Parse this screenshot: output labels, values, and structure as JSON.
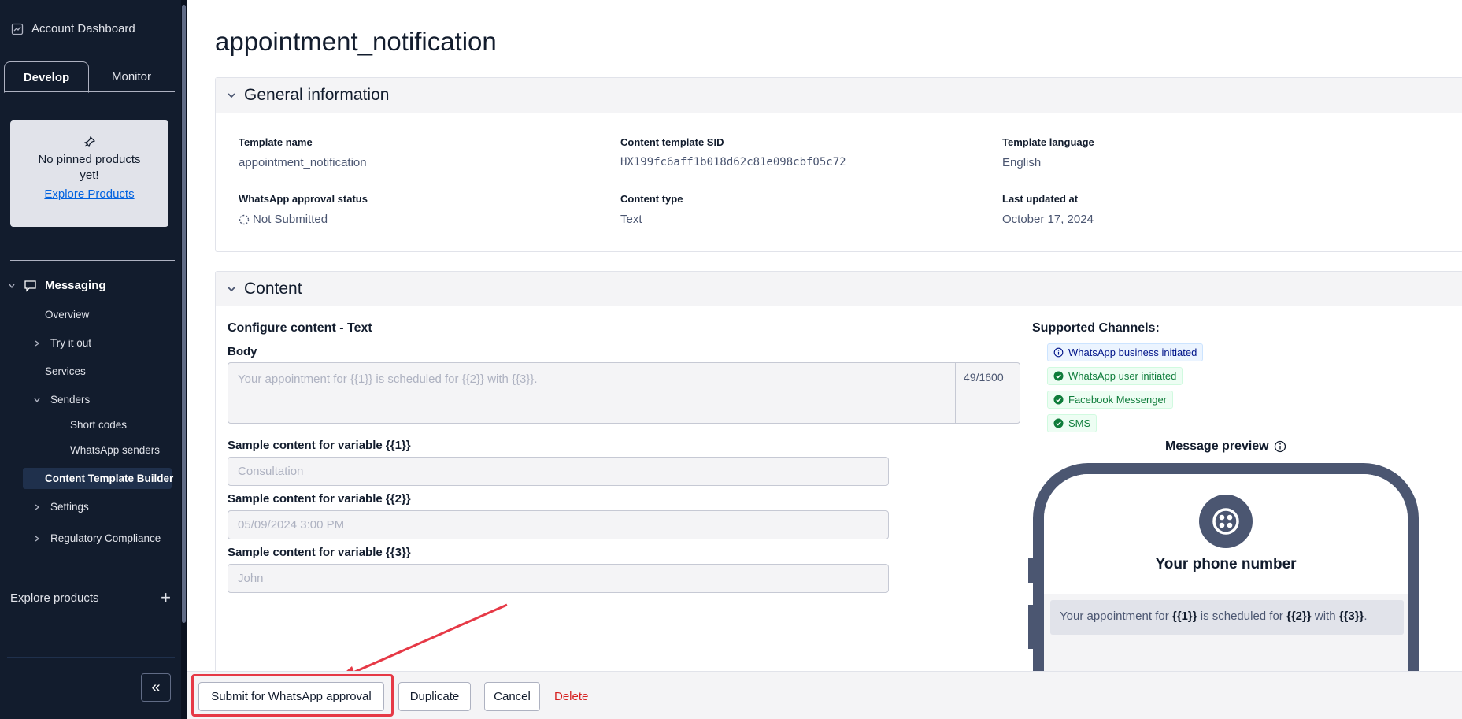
{
  "sidebar": {
    "account_label": "Account Dashboard",
    "tabs": [
      {
        "label": "Develop",
        "active": true
      },
      {
        "label": "Monitor",
        "active": false
      }
    ],
    "pinned": {
      "line1": "No pinned products",
      "line2": "yet!",
      "link": "Explore Products"
    },
    "nav": {
      "messaging": "Messaging",
      "overview": "Overview",
      "try_it_out": "Try it out",
      "services": "Services",
      "senders": "Senders",
      "short_codes": "Short codes",
      "whatsapp_senders": "WhatsApp senders",
      "content_template_builder": "Content Template Builder",
      "settings": "Settings",
      "regulatory_compliance": "Regulatory Compliance"
    },
    "explore_products": "Explore products",
    "explore_plus": "+",
    "collapse_glyph": "«"
  },
  "page": {
    "title": "appointment_notification"
  },
  "general": {
    "heading": "General information",
    "template_name_label": "Template name",
    "template_name_value": "appointment_notification",
    "sid_label": "Content template SID",
    "sid_value": "HX199fc6aff1b018d62c81e098cbf05c72",
    "language_label": "Template language",
    "language_value": "English",
    "approval_label": "WhatsApp approval status",
    "approval_value": "Not Submitted",
    "content_type_label": "Content type",
    "content_type_value": "Text",
    "updated_label": "Last updated at",
    "updated_value": "October 17, 2024"
  },
  "content": {
    "heading": "Content",
    "configure_title": "Configure content - Text",
    "body_label": "Body",
    "body_placeholder": "Your appointment for {{1}} is scheduled for {{2}} with {{3}}.",
    "body_count": "49/1600",
    "var1_label": "Sample content for variable {{1}}",
    "var1_placeholder": "Consultation",
    "var2_label": "Sample content for variable {{2}}",
    "var2_placeholder": "05/09/2024 3:00 PM",
    "var3_label": "Sample content for variable {{3}}",
    "var3_placeholder": "John"
  },
  "channels": {
    "title": "Supported Channels:",
    "items": [
      "WhatsApp business initiated",
      "WhatsApp user initiated",
      "Facebook Messenger",
      "SMS"
    ]
  },
  "preview": {
    "title": "Message preview",
    "phone_number": "Your phone number",
    "msg_prefix": "Your appointment for ",
    "msg_v1": "{{1}}",
    "msg_mid1": " is scheduled for ",
    "msg_v2": "{{2}}",
    "msg_mid2": " with ",
    "msg_v3": "{{3}}",
    "msg_end": "."
  },
  "footer": {
    "submit": "Submit for WhatsApp approval",
    "duplicate": "Duplicate",
    "cancel": "Cancel",
    "delete": "Delete"
  },
  "colors": {
    "sidebar_bg": "#121c2d",
    "accent_link": "#0263e0",
    "delete_red": "#d61f1f",
    "highlight_red": "#e63946",
    "success_green": "#0e7c3a"
  }
}
